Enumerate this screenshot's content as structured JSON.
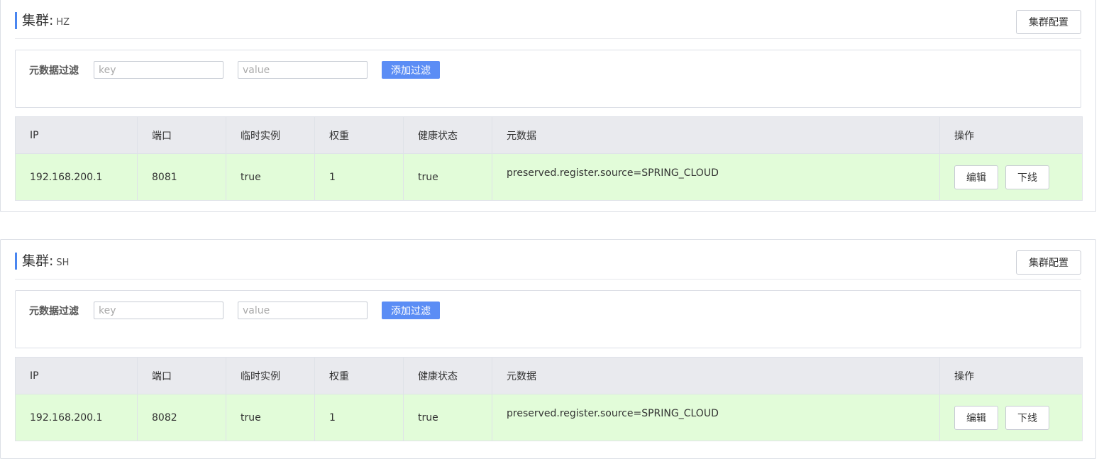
{
  "clusters": [
    {
      "label": "集群:",
      "name": "HZ",
      "config_button": "集群配置",
      "filter": {
        "label": "元数据过滤",
        "key_placeholder": "key",
        "value_placeholder": "value",
        "key_value": "",
        "value_value": "",
        "add_button": "添加过滤"
      },
      "columns": [
        "IP",
        "端口",
        "临时实例",
        "权重",
        "健康状态",
        "元数据",
        "操作"
      ],
      "rows": [
        {
          "ip": "192.168.200.1",
          "port": "8081",
          "ephemeral": "true",
          "weight": "1",
          "healthy": "true",
          "metadata": "preserved.register.source=SPRING_CLOUD",
          "edit_button": "编辑",
          "offline_button": "下线"
        }
      ]
    },
    {
      "label": "集群:",
      "name": "SH",
      "config_button": "集群配置",
      "filter": {
        "label": "元数据过滤",
        "key_placeholder": "key",
        "value_placeholder": "value",
        "key_value": "",
        "value_value": "",
        "add_button": "添加过滤"
      },
      "columns": [
        "IP",
        "端口",
        "临时实例",
        "权重",
        "健康状态",
        "元数据",
        "操作"
      ],
      "rows": [
        {
          "ip": "192.168.200.1",
          "port": "8082",
          "ephemeral": "true",
          "weight": "1",
          "healthy": "true",
          "metadata": "preserved.register.source=SPRING_CLOUD",
          "edit_button": "编辑",
          "offline_button": "下线"
        }
      ]
    }
  ],
  "colors": {
    "accent": "#4a86f0",
    "primary_button": "#5b8df5",
    "header_bg": "#e9eaee",
    "row_bg": "#e2fcd9"
  }
}
